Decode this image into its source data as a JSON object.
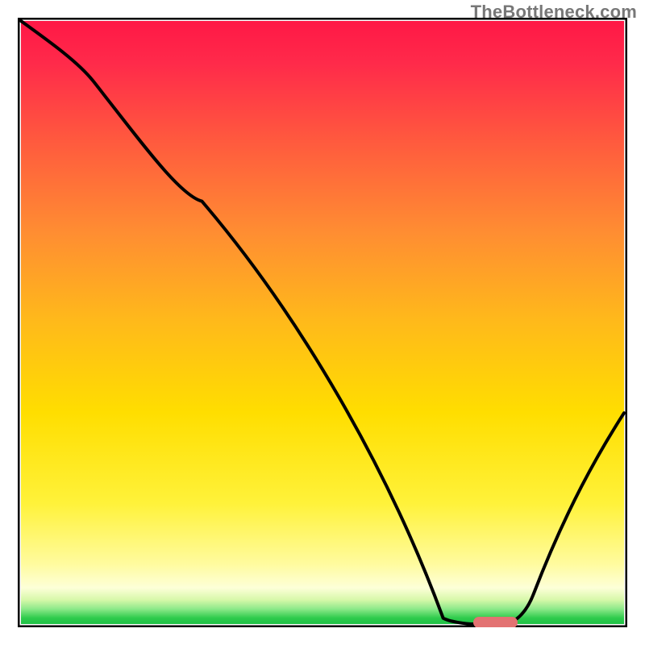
{
  "header": {
    "watermark": "TheBottleneck.com"
  },
  "chart_data": {
    "type": "line",
    "title": "",
    "xlabel": "",
    "ylabel": "",
    "xlim": [
      0,
      100
    ],
    "ylim": [
      0,
      100
    ],
    "grid": false,
    "series": [
      {
        "name": "bottleneck-curve",
        "x": [
          0,
          12,
          30,
          70,
          75,
          80,
          85,
          100
        ],
        "values": [
          100,
          90,
          70,
          1,
          0,
          0,
          5,
          35
        ]
      }
    ],
    "marker": {
      "name": "optimal-range",
      "x_start": 75,
      "x_end": 82,
      "y": 0,
      "color": "#e37272"
    },
    "background": {
      "type": "gradient-band",
      "bands": [
        {
          "y": 100,
          "color": "#ff1846"
        },
        {
          "y": 50,
          "color": "#ffde00"
        },
        {
          "y": 7,
          "color": "#fffb9e"
        },
        {
          "y": 1,
          "color": "#2ecb4c"
        }
      ]
    }
  }
}
